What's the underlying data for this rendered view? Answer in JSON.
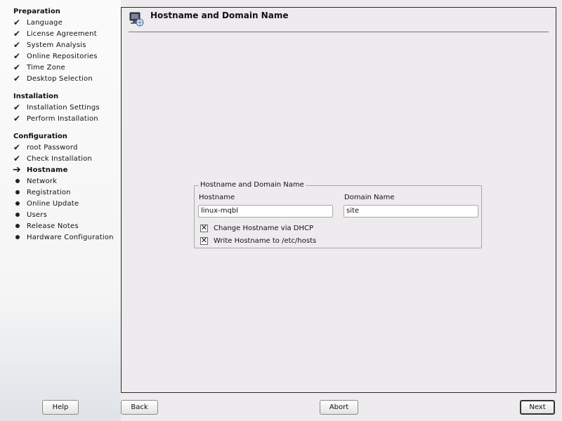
{
  "sidebar": {
    "sections": [
      {
        "title": "Preparation",
        "steps": [
          {
            "label": "Language",
            "status": "done"
          },
          {
            "label": "License Agreement",
            "status": "done"
          },
          {
            "label": "System Analysis",
            "status": "done"
          },
          {
            "label": "Online Repositories",
            "status": "done"
          },
          {
            "label": "Time Zone",
            "status": "done"
          },
          {
            "label": "Desktop Selection",
            "status": "done"
          }
        ]
      },
      {
        "title": "Installation",
        "steps": [
          {
            "label": "Installation Settings",
            "status": "done"
          },
          {
            "label": "Perform Installation",
            "status": "done"
          }
        ]
      },
      {
        "title": "Configuration",
        "steps": [
          {
            "label": "root Password",
            "status": "done"
          },
          {
            "label": "Check Installation",
            "status": "done"
          },
          {
            "label": "Hostname",
            "status": "current"
          },
          {
            "label": "Network",
            "status": "pending"
          },
          {
            "label": "Registration",
            "status": "pending"
          },
          {
            "label": "Online Update",
            "status": "pending"
          },
          {
            "label": "Users",
            "status": "pending"
          },
          {
            "label": "Release Notes",
            "status": "pending"
          },
          {
            "label": "Hardware Configuration",
            "status": "pending"
          }
        ]
      }
    ]
  },
  "main": {
    "title": "Hostname and Domain Name",
    "group": {
      "legend": "Hostname and Domain Name",
      "hostname_label": "Hostname",
      "hostname_value": "linux-mqbl",
      "domain_label": "Domain Name",
      "domain_value": "site",
      "dhcp_checkbox": {
        "label": "Change Hostname via DHCP",
        "checked": true
      },
      "hosts_checkbox": {
        "label": "Write Hostname to /etc/hosts",
        "checked": true
      }
    }
  },
  "buttons": {
    "help": "Help",
    "back": "Back",
    "abort": "Abort",
    "next": "Next"
  }
}
